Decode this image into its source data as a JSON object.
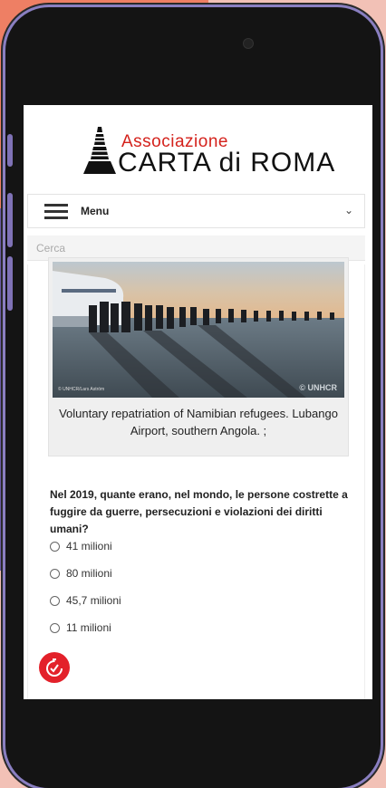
{
  "header": {
    "logo_line1": "Associazione",
    "logo_line2": "CARTA di ROMA"
  },
  "menu": {
    "label": "Menu"
  },
  "search": {
    "placeholder": "Cerca"
  },
  "photo": {
    "credit": "© UNHCR/Lars Astróm",
    "watermark": "© UNHCR",
    "caption": "Voluntary repatriation of Namibian refugees. Lubango Airport, southern Angola. ;"
  },
  "quiz": {
    "question": "Nel 2019, quante erano, nel mondo, le persone costrette a fuggire da guerre, persecuzioni e violazioni dei diritti umani?",
    "options": [
      "41 milioni",
      "80 milioni",
      "45,7 milioni",
      "11 milioni"
    ]
  },
  "colors": {
    "accent": "#d4221c",
    "fab": "#e3212a",
    "background": "#f2c1b6",
    "frame": "#8a7fc1"
  }
}
